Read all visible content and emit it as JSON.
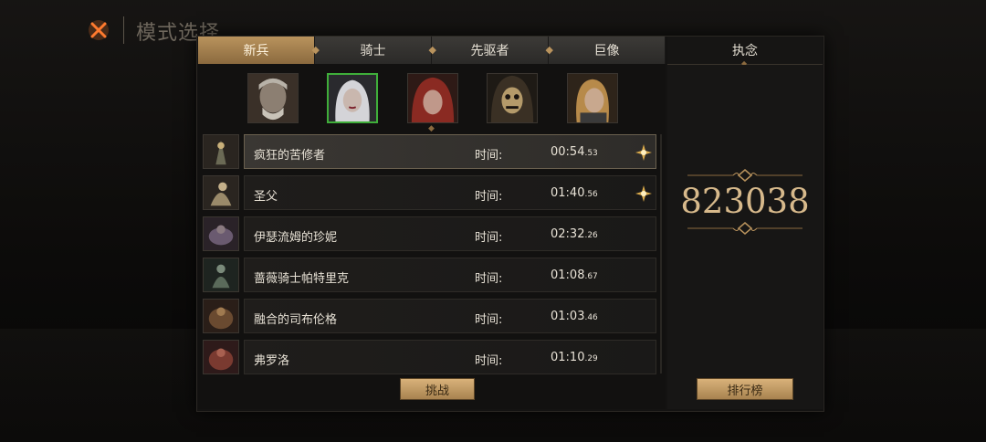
{
  "header": {
    "title": "模式选择",
    "close_icon": "close-x-icon"
  },
  "tabs": [
    {
      "label": "新兵",
      "active": true
    },
    {
      "label": "骑士",
      "active": false
    },
    {
      "label": "先驱者",
      "active": false
    },
    {
      "label": "巨像",
      "active": false
    }
  ],
  "side_tab": {
    "label": "执念"
  },
  "portraits": [
    {
      "name": "portrait-old-man",
      "selected": false
    },
    {
      "name": "portrait-white-haired-woman",
      "selected": true
    },
    {
      "name": "portrait-red-hooded-woman",
      "selected": false
    },
    {
      "name": "portrait-masked-hood",
      "selected": false
    },
    {
      "name": "portrait-blonde-woman",
      "selected": false
    }
  ],
  "boss_list": [
    {
      "name": "疯狂的苦修者",
      "time_label": "时间:",
      "time_main": "00:54",
      "time_ms": ".53",
      "has_emblem": true,
      "active": true
    },
    {
      "name": "圣父",
      "time_label": "时间:",
      "time_main": "01:40",
      "time_ms": ".56",
      "has_emblem": true,
      "active": false
    },
    {
      "name": "伊瑟流姆的珍妮",
      "time_label": "时间:",
      "time_main": "02:32",
      "time_ms": ".26",
      "has_emblem": false,
      "active": false
    },
    {
      "name": "蔷薇骑士帕特里克",
      "time_label": "时间:",
      "time_main": "01:08",
      "time_ms": ".67",
      "has_emblem": false,
      "active": false
    },
    {
      "name": "融合的司布伦格",
      "time_label": "时间:",
      "time_main": "01:03",
      "time_ms": ".46",
      "has_emblem": false,
      "active": false
    },
    {
      "name": "弗罗洛",
      "time_label": "时间:",
      "time_main": "01:10",
      "time_ms": ".29",
      "has_emblem": false,
      "active": false
    }
  ],
  "score": "823038",
  "buttons": {
    "challenge": "挑战",
    "leaderboard": "排行榜"
  },
  "colors": {
    "accent_gold": "#d7b98b",
    "tab_active": "#b9935d",
    "selected_border": "#3fae3a"
  }
}
